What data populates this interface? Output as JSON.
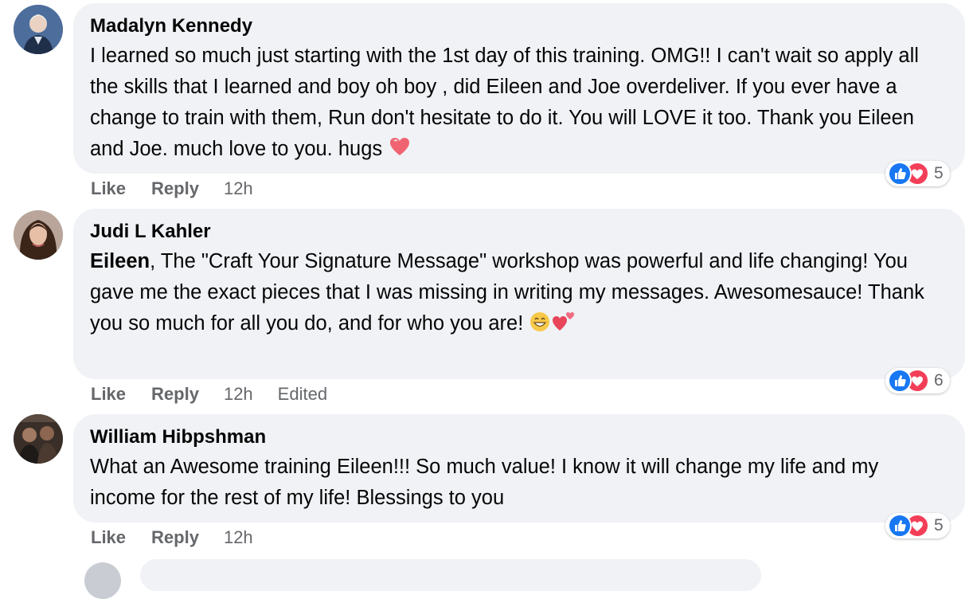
{
  "comments": [
    {
      "author": "Madalyn Kennedy",
      "text": "I learned so much just starting with the 1st day of this training. OMG!! I can't wait so apply all the skills that I learned and boy oh boy , did Eileen and Joe overdeliver. If you ever have a change to train with them, Run don't hesitate to do it. You will LOVE it too. Thank you Eileen and Joe. much love to you. hugs",
      "like": "Like",
      "reply": "Reply",
      "time": "12h",
      "reactions": "5"
    },
    {
      "author": "Judi L Kahler",
      "mention": "Eileen",
      "text": ", The \"Craft Your Signature Message\" workshop was powerful and life changing! You gave me the exact pieces that I was missing in writing my messages. Awesomesauce! Thank you so much for all you do, and for who you are!",
      "like": "Like",
      "reply": "Reply",
      "time": "12h",
      "edited": "Edited",
      "reactions": "6"
    },
    {
      "author": "William Hibpshman",
      "text": "What an Awesome training Eileen!!! So much value! I know it will change my life and my income for the rest of my life! Blessings to you",
      "like": "Like",
      "reply": "Reply",
      "time": "12h",
      "reactions": "5"
    }
  ],
  "colors": {
    "bubble": "#f0f2f5",
    "like_blue": "#1877f2",
    "love_red": "#f33e58",
    "meta_gray": "#65676b"
  }
}
